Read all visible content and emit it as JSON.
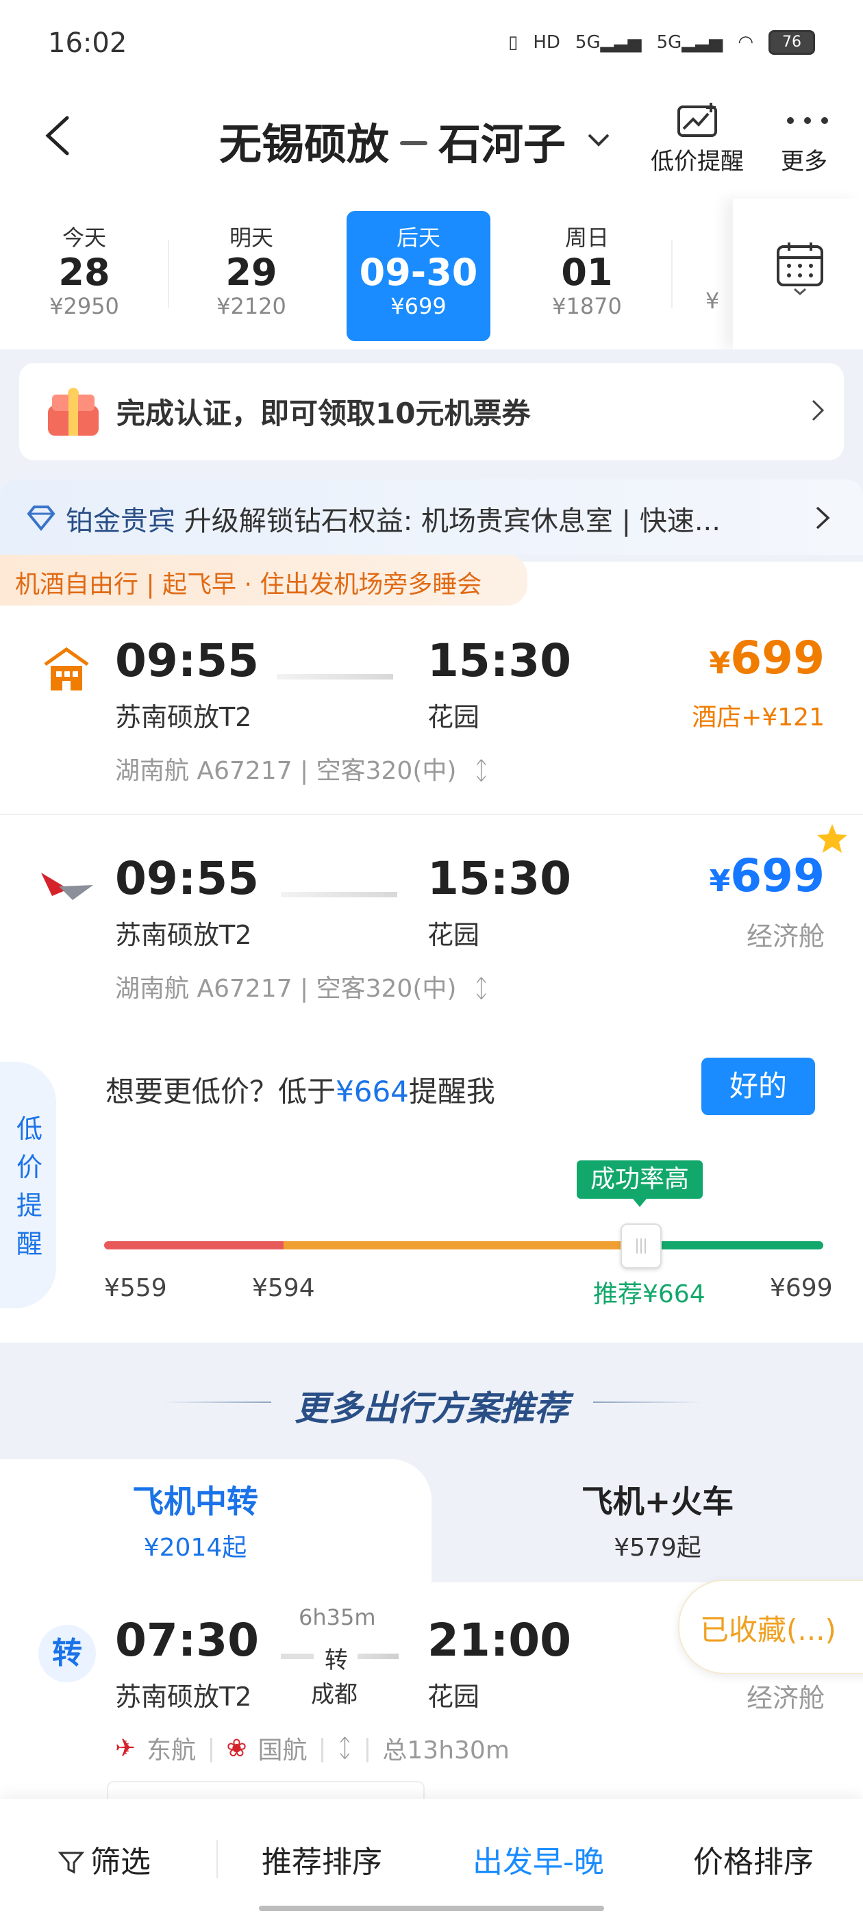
{
  "status": {
    "time": "16:02",
    "battery": "76",
    "signal1": "5G",
    "signal2": "5G",
    "hd": "HD"
  },
  "header": {
    "from": "无锡硕放",
    "to": "石河子",
    "price_alert_label": "低价提醒",
    "more_label": "更多"
  },
  "dates": [
    {
      "label": "今天",
      "day": "28",
      "price": "¥2950"
    },
    {
      "label": "明天",
      "day": "29",
      "price": "¥2120"
    },
    {
      "label": "后天",
      "day": "09-30",
      "price": "¥699"
    },
    {
      "label": "周日",
      "day": "01",
      "price": "¥1870"
    },
    {
      "price_partial": "¥"
    }
  ],
  "coupon": {
    "text": "完成认证，即可领取10元机票券"
  },
  "vip": {
    "level": "铂金贵宾",
    "text": "升级解锁钻石权益: 机场贵宾休息室 | 快速..."
  },
  "tag_strip": {
    "text": "机酒自由行 | 起飞早 · 住出发机场旁多睡会"
  },
  "flights": [
    {
      "dep_time": "09:55",
      "dep_airport": "苏南硕放T2",
      "arr_time": "15:30",
      "arr_airport": "花园",
      "meta": "湖南航 A67217 | 空客320(中)",
      "price": "699",
      "currency": "¥",
      "sub": "酒店+¥121"
    },
    {
      "dep_time": "09:55",
      "dep_airport": "苏南硕放T2",
      "arr_time": "15:30",
      "arr_airport": "花园",
      "meta": "湖南航 A67217 | 空客320(中)",
      "price": "699",
      "currency": "¥",
      "sub": "经济舱"
    }
  ],
  "low_price_alert": {
    "side_label": [
      "低",
      "价",
      "提",
      "醒"
    ],
    "text_prefix": "想要更低价？低于",
    "text_price": "¥664",
    "text_suffix": "提醒我",
    "ok_button": "好的",
    "rate_badge": "成功率高",
    "labels": [
      "¥559",
      "¥594",
      "推荐¥664",
      "¥699"
    ],
    "selected_fraction": 0.81
  },
  "more_plans": {
    "title": "更多出行方案推荐",
    "tabs": [
      {
        "title": "飞机中转",
        "price": "¥2014起"
      },
      {
        "title": "飞机+火车",
        "price": "¥579起"
      }
    ]
  },
  "transfer_flight": {
    "badge": "转",
    "dep_time": "07:30",
    "dep_airport": "苏南硕放T2",
    "duration": "6h35m",
    "transfer_label": "转",
    "transfer_city": "成都",
    "arr_time": "21:00",
    "arr_airport": "花园",
    "airline1": "东航",
    "airline2": "国航",
    "total": "总13h30m",
    "fav_label": "已收藏(...)",
    "cabin": "经济舱"
  },
  "bottom_bar": {
    "filter": "筛选",
    "recommend": "推荐排序",
    "depart": "出发早-晚",
    "price": "价格排序"
  },
  "colors": {
    "accent": "#1a8cff",
    "orange": "#f07c00",
    "green": "#12a86b",
    "red": "#e85a5a"
  }
}
